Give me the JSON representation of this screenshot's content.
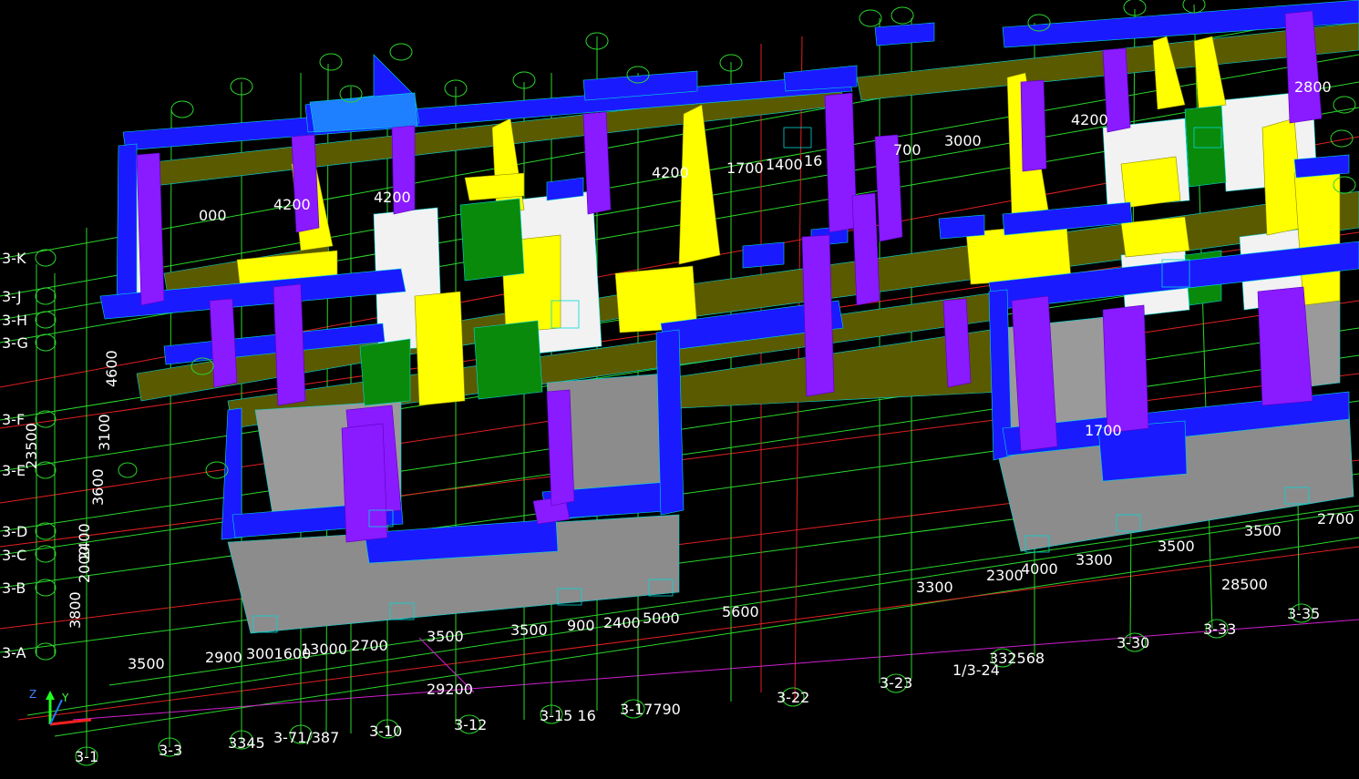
{
  "colors": {
    "background": "#000000",
    "grid_green": "#2bd62b",
    "grid_red": "#e02020",
    "magenta": "#d020d0",
    "wall_blue": "#1a1aff",
    "column_purple": "#8a1aff",
    "beam_olive": "#5a5a00",
    "slab_gray": "#8c8c8c",
    "white_block": "#f2f2f2",
    "yellow_block": "#ffff00",
    "green_block": "#0a8a0a",
    "cyan_outline": "#00d8d8",
    "label_text": "#ffffff"
  },
  "ucs_icon": {
    "z_label": "Z",
    "y_label": "Y"
  },
  "row_axes": [
    {
      "label": "3-K"
    },
    {
      "label": "3-J"
    },
    {
      "label": "3-H"
    },
    {
      "label": "3-G"
    },
    {
      "label": "3-F"
    },
    {
      "label": "3-E"
    },
    {
      "label": "3-D"
    },
    {
      "label": "3-C"
    },
    {
      "label": "3-B"
    },
    {
      "label": "3-A"
    }
  ],
  "column_axes": [
    {
      "label": "3-1"
    },
    {
      "label": "3-3"
    },
    {
      "label": "3345"
    },
    {
      "label": "3-71/387"
    },
    {
      "label": "3-10"
    },
    {
      "label": "3-12"
    },
    {
      "label": "3-15 16"
    },
    {
      "label": "3-17790"
    },
    {
      "label": "3-22"
    },
    {
      "label": "3-23"
    },
    {
      "label": "1/3-24"
    },
    {
      "label": "332568"
    },
    {
      "label": "3-30"
    },
    {
      "label": "3-33"
    },
    {
      "label": "3-35"
    }
  ],
  "dimensions": {
    "left_vertical": [
      "4600",
      "3100",
      "3600",
      "2400",
      "2000",
      "3800",
      "23500"
    ],
    "bottom_row1": [
      "3500",
      "2900",
      "3001600",
      "13000",
      "2700",
      "3500",
      "3500",
      "900",
      "2400",
      "5000",
      "5600"
    ],
    "bottom_total": "29200",
    "right_row": [
      "3300",
      "2300",
      "4000",
      "3300",
      "3500",
      "3500",
      "2700"
    ],
    "right_total": "28500",
    "top_row": [
      "4200",
      "4200",
      "4200",
      "1700",
      "1400",
      "16",
      "000",
      "700",
      "3000",
      "4200",
      "2800",
      "1700"
    ]
  }
}
